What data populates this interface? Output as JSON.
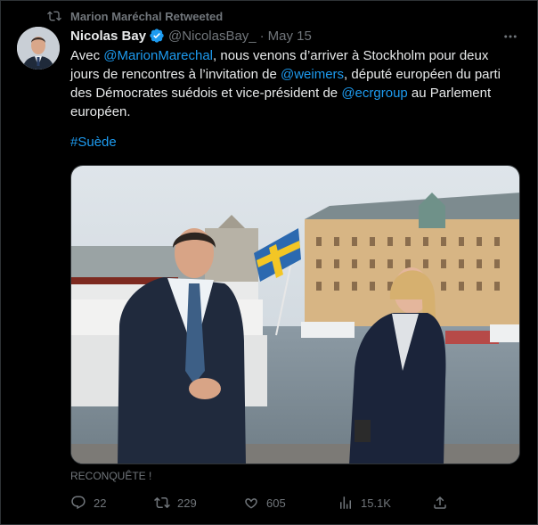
{
  "retweet": {
    "label": "Marion Maréchal Retweeted",
    "icon": "retweet-icon"
  },
  "author": {
    "name": "Nicolas Bay",
    "handle": "@NicolasBay_",
    "date": "May 15",
    "verified": true,
    "verified_color": "#1d9bf0"
  },
  "tweet": {
    "segments": [
      {
        "text": "Avec "
      },
      {
        "text": "@MarionMarechal",
        "link": true
      },
      {
        "text": ", nous venons d’arriver à Stockholm pour deux jours de rencontres à l’invitation de "
      },
      {
        "text": "@weimers",
        "link": true
      },
      {
        "text": ", député européen du parti des Démocrates suédois et vice-président de "
      },
      {
        "text": "@ecrgroup",
        "link": true
      },
      {
        "text": " au Parlement européen."
      }
    ],
    "hashtag": "#Suède"
  },
  "media_caption": "RECONQUÊTE !",
  "actions": {
    "replies": "22",
    "retweets": "229",
    "likes": "605",
    "views": "15.1K"
  },
  "colors": {
    "background": "#000000",
    "text": "#e7e9ea",
    "muted": "#71767b",
    "link": "#1d9bf0"
  }
}
